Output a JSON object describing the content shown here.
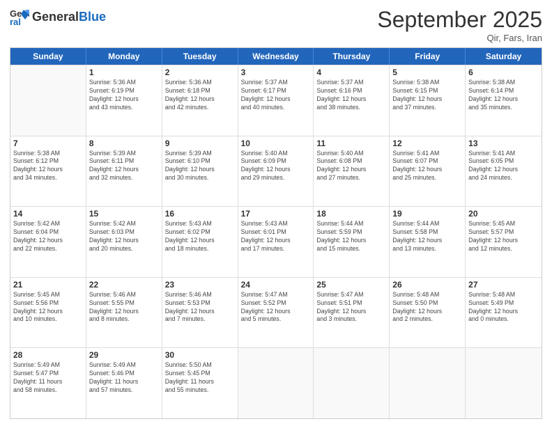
{
  "header": {
    "logo_general": "General",
    "logo_blue": "Blue",
    "month": "September 2025",
    "location": "Qir, Fars, Iran"
  },
  "weekdays": [
    "Sunday",
    "Monday",
    "Tuesday",
    "Wednesday",
    "Thursday",
    "Friday",
    "Saturday"
  ],
  "rows": [
    [
      {
        "day": "",
        "info": ""
      },
      {
        "day": "1",
        "info": "Sunrise: 5:36 AM\nSunset: 6:19 PM\nDaylight: 12 hours\nand 43 minutes."
      },
      {
        "day": "2",
        "info": "Sunrise: 5:36 AM\nSunset: 6:18 PM\nDaylight: 12 hours\nand 42 minutes."
      },
      {
        "day": "3",
        "info": "Sunrise: 5:37 AM\nSunset: 6:17 PM\nDaylight: 12 hours\nand 40 minutes."
      },
      {
        "day": "4",
        "info": "Sunrise: 5:37 AM\nSunset: 6:16 PM\nDaylight: 12 hours\nand 38 minutes."
      },
      {
        "day": "5",
        "info": "Sunrise: 5:38 AM\nSunset: 6:15 PM\nDaylight: 12 hours\nand 37 minutes."
      },
      {
        "day": "6",
        "info": "Sunrise: 5:38 AM\nSunset: 6:14 PM\nDaylight: 12 hours\nand 35 minutes."
      }
    ],
    [
      {
        "day": "7",
        "info": "Sunrise: 5:38 AM\nSunset: 6:12 PM\nDaylight: 12 hours\nand 34 minutes."
      },
      {
        "day": "8",
        "info": "Sunrise: 5:39 AM\nSunset: 6:11 PM\nDaylight: 12 hours\nand 32 minutes."
      },
      {
        "day": "9",
        "info": "Sunrise: 5:39 AM\nSunset: 6:10 PM\nDaylight: 12 hours\nand 30 minutes."
      },
      {
        "day": "10",
        "info": "Sunrise: 5:40 AM\nSunset: 6:09 PM\nDaylight: 12 hours\nand 29 minutes."
      },
      {
        "day": "11",
        "info": "Sunrise: 5:40 AM\nSunset: 6:08 PM\nDaylight: 12 hours\nand 27 minutes."
      },
      {
        "day": "12",
        "info": "Sunrise: 5:41 AM\nSunset: 6:07 PM\nDaylight: 12 hours\nand 25 minutes."
      },
      {
        "day": "13",
        "info": "Sunrise: 5:41 AM\nSunset: 6:05 PM\nDaylight: 12 hours\nand 24 minutes."
      }
    ],
    [
      {
        "day": "14",
        "info": "Sunrise: 5:42 AM\nSunset: 6:04 PM\nDaylight: 12 hours\nand 22 minutes."
      },
      {
        "day": "15",
        "info": "Sunrise: 5:42 AM\nSunset: 6:03 PM\nDaylight: 12 hours\nand 20 minutes."
      },
      {
        "day": "16",
        "info": "Sunrise: 5:43 AM\nSunset: 6:02 PM\nDaylight: 12 hours\nand 18 minutes."
      },
      {
        "day": "17",
        "info": "Sunrise: 5:43 AM\nSunset: 6:01 PM\nDaylight: 12 hours\nand 17 minutes."
      },
      {
        "day": "18",
        "info": "Sunrise: 5:44 AM\nSunset: 5:59 PM\nDaylight: 12 hours\nand 15 minutes."
      },
      {
        "day": "19",
        "info": "Sunrise: 5:44 AM\nSunset: 5:58 PM\nDaylight: 12 hours\nand 13 minutes."
      },
      {
        "day": "20",
        "info": "Sunrise: 5:45 AM\nSunset: 5:57 PM\nDaylight: 12 hours\nand 12 minutes."
      }
    ],
    [
      {
        "day": "21",
        "info": "Sunrise: 5:45 AM\nSunset: 5:56 PM\nDaylight: 12 hours\nand 10 minutes."
      },
      {
        "day": "22",
        "info": "Sunrise: 5:46 AM\nSunset: 5:55 PM\nDaylight: 12 hours\nand 8 minutes."
      },
      {
        "day": "23",
        "info": "Sunrise: 5:46 AM\nSunset: 5:53 PM\nDaylight: 12 hours\nand 7 minutes."
      },
      {
        "day": "24",
        "info": "Sunrise: 5:47 AM\nSunset: 5:52 PM\nDaylight: 12 hours\nand 5 minutes."
      },
      {
        "day": "25",
        "info": "Sunrise: 5:47 AM\nSunset: 5:51 PM\nDaylight: 12 hours\nand 3 minutes."
      },
      {
        "day": "26",
        "info": "Sunrise: 5:48 AM\nSunset: 5:50 PM\nDaylight: 12 hours\nand 2 minutes."
      },
      {
        "day": "27",
        "info": "Sunrise: 5:48 AM\nSunset: 5:49 PM\nDaylight: 12 hours\nand 0 minutes."
      }
    ],
    [
      {
        "day": "28",
        "info": "Sunrise: 5:49 AM\nSunset: 5:47 PM\nDaylight: 11 hours\nand 58 minutes."
      },
      {
        "day": "29",
        "info": "Sunrise: 5:49 AM\nSunset: 5:46 PM\nDaylight: 11 hours\nand 57 minutes."
      },
      {
        "day": "30",
        "info": "Sunrise: 5:50 AM\nSunset: 5:45 PM\nDaylight: 11 hours\nand 55 minutes."
      },
      {
        "day": "",
        "info": ""
      },
      {
        "day": "",
        "info": ""
      },
      {
        "day": "",
        "info": ""
      },
      {
        "day": "",
        "info": ""
      }
    ]
  ]
}
